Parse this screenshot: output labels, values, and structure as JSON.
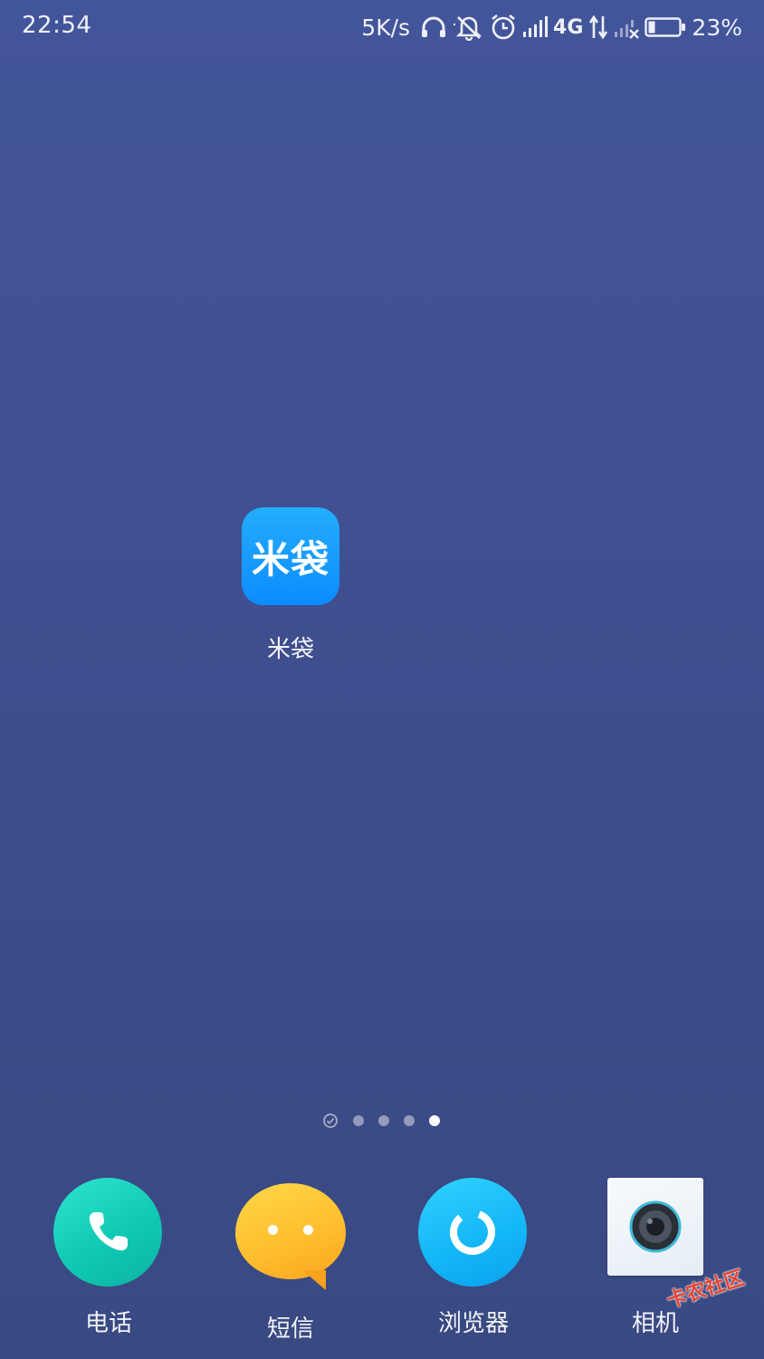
{
  "status_bar": {
    "time": "22:54",
    "net_speed": "5K/s",
    "network_type": "4G",
    "battery_percent": "23%",
    "battery_level": 0.23,
    "icons": [
      "headphones-icon",
      "mute-bell-icon",
      "alarm-icon",
      "signal-icon",
      "data-arrows-icon",
      "signal-no-sim-icon",
      "battery-icon"
    ]
  },
  "home": {
    "apps": [
      {
        "label": "米袋",
        "icon_text": "米袋",
        "color": "#1a9dff"
      }
    ]
  },
  "page_indicator": {
    "page_count": 5,
    "current_page": 5,
    "first_icon": "check-circle-icon"
  },
  "dock": {
    "items": [
      {
        "label": "电话",
        "icon": "phone-icon"
      },
      {
        "label": "短信",
        "icon": "sms-bubble-icon"
      },
      {
        "label": "浏览器",
        "icon": "browser-icon"
      },
      {
        "label": "相机",
        "icon": "camera-icon"
      }
    ]
  },
  "watermark": {
    "text": "卡农社区"
  }
}
